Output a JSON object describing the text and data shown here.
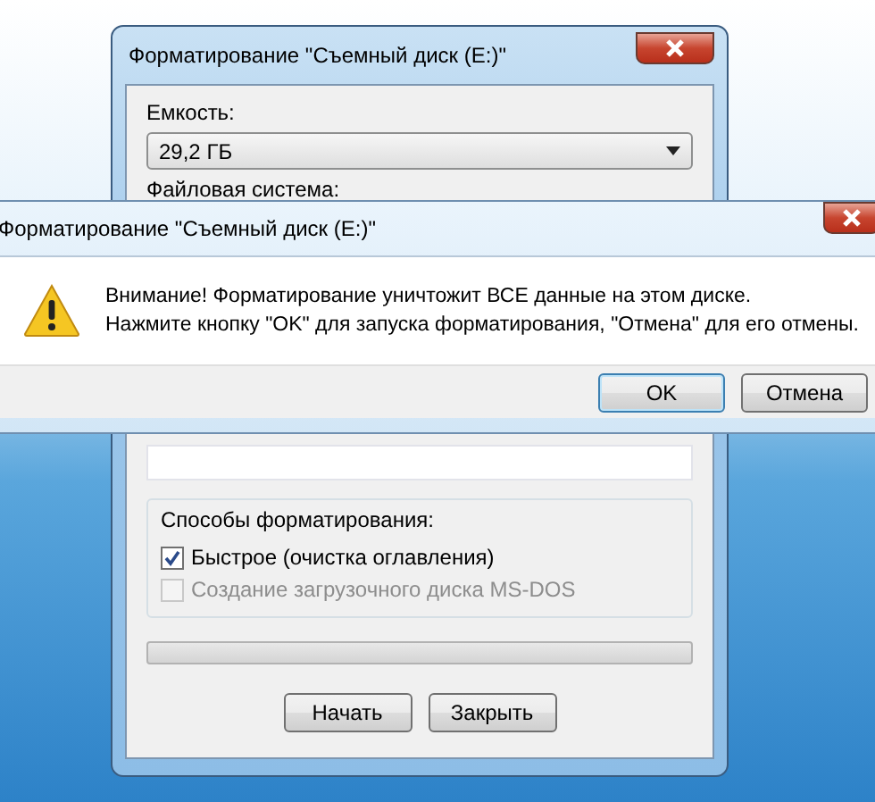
{
  "format_window": {
    "title": "Форматирование \"Съемный диск (E:)\"",
    "capacity": {
      "label": "Емкость:",
      "value": "29,2 ГБ"
    },
    "file_system": {
      "label": "Файловая система:"
    },
    "format_options": {
      "label": "Способы форматирования:",
      "options": [
        {
          "label": "Быстрое (очистка оглавления)",
          "checked": true,
          "disabled": false
        },
        {
          "label": "Создание загрузочного диска MS-DOS",
          "checked": false,
          "disabled": true
        }
      ]
    },
    "progress": {
      "level": 0
    },
    "buttons": [
      {
        "label": "Начать"
      },
      {
        "label": "Закрыть"
      }
    ]
  },
  "alert": {
    "title": "Форматирование \"Съемный диск (E:)\"",
    "message_lines": [
      "Внимание! Форматирование уничтожит ВСЕ данные на этом диске.",
      "Нажмите кнопку \"OK\" для запуска форматирования, \"Отмена\" для его отмены."
    ],
    "buttons": [
      {
        "label": "OK",
        "default": true
      },
      {
        "label": "Отмена",
        "default": false
      }
    ]
  }
}
